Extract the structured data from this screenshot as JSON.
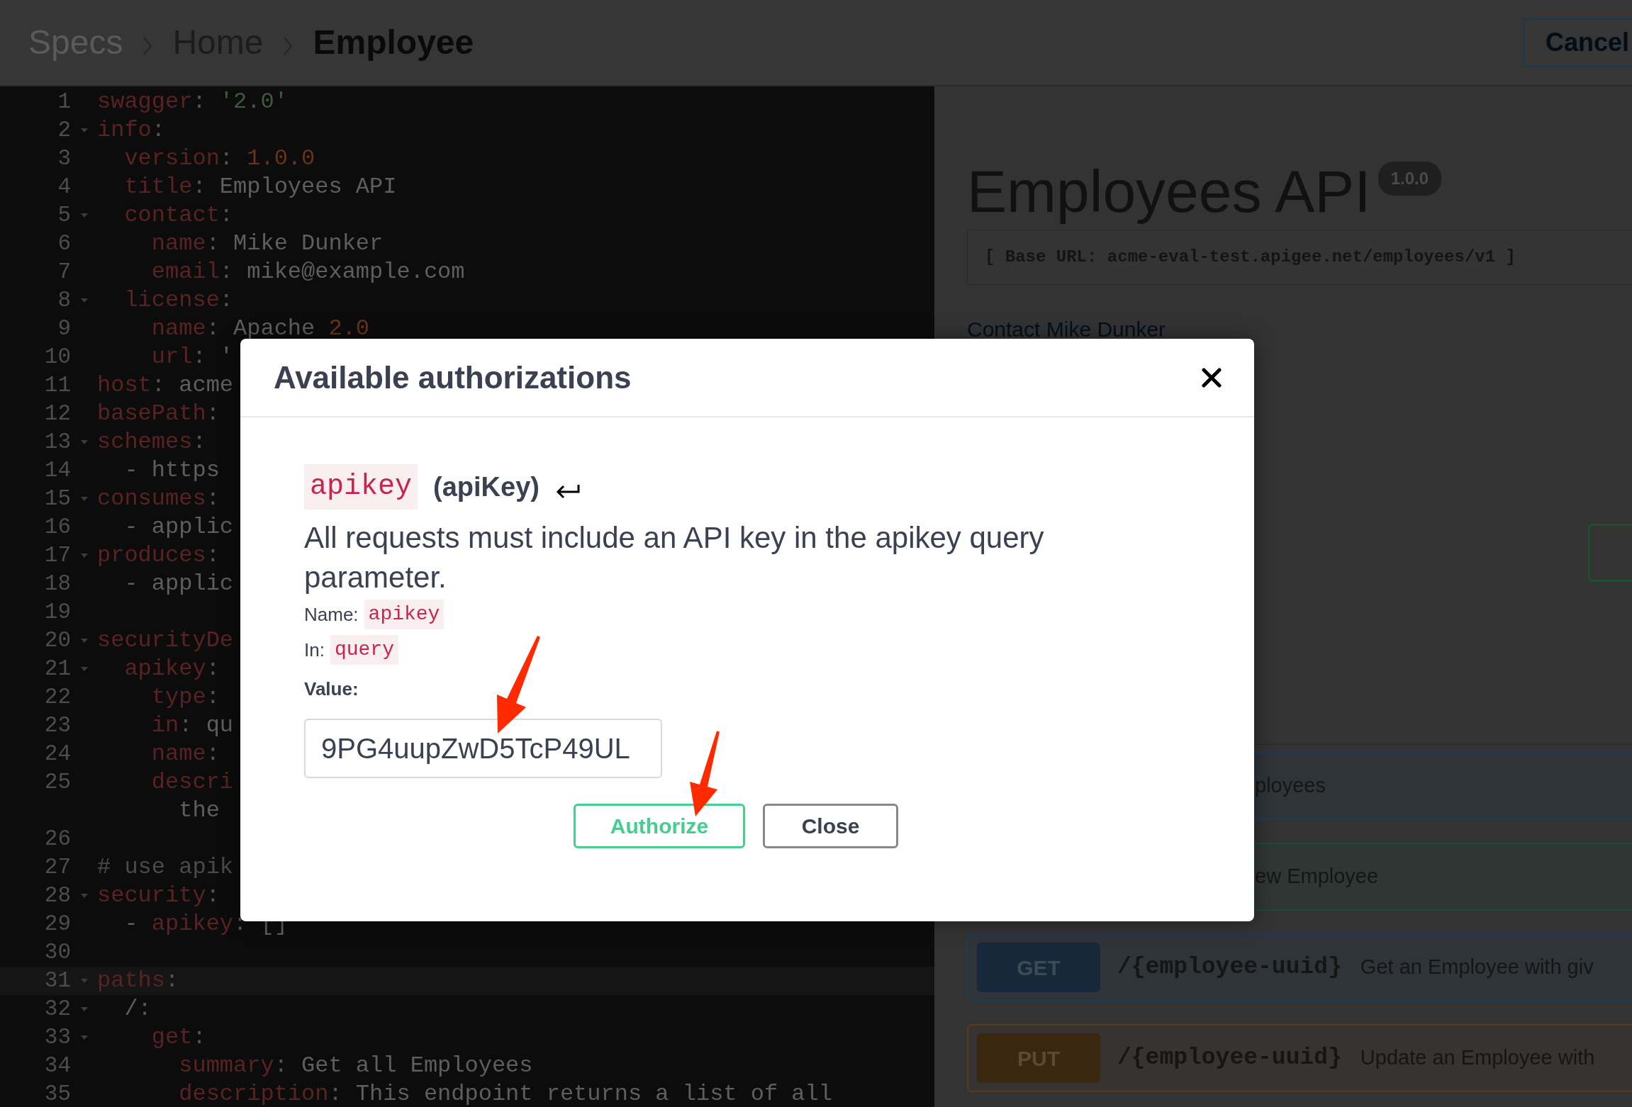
{
  "breadcrumb": [
    {
      "label": "Specs",
      "current": false
    },
    {
      "label": "Home",
      "current": false
    },
    {
      "label": "Employee",
      "current": true
    }
  ],
  "cancel_button": "Cancel",
  "editor": {
    "lines": [
      {
        "number": "1",
        "fold": false,
        "active": false,
        "tokens": [
          {
            "kind": "key",
            "text": "swagger"
          },
          {
            "kind": "punct",
            "text": ": "
          },
          {
            "kind": "string",
            "text": "'2.0'"
          }
        ]
      },
      {
        "number": "2",
        "fold": true,
        "active": false,
        "tokens": [
          {
            "kind": "key",
            "text": "info"
          },
          {
            "kind": "punct",
            "text": ":"
          }
        ]
      },
      {
        "number": "3",
        "fold": false,
        "active": false,
        "tokens": [
          {
            "kind": "key",
            "text": "  version"
          },
          {
            "kind": "punct",
            "text": ": "
          },
          {
            "kind": "number",
            "text": "1.0.0"
          }
        ]
      },
      {
        "number": "4",
        "fold": false,
        "active": false,
        "tokens": [
          {
            "kind": "key",
            "text": "  title"
          },
          {
            "kind": "punct",
            "text": ": "
          },
          {
            "kind": "text",
            "text": "Employees API"
          }
        ]
      },
      {
        "number": "5",
        "fold": true,
        "active": false,
        "tokens": [
          {
            "kind": "key",
            "text": "  contact"
          },
          {
            "kind": "punct",
            "text": ":"
          }
        ]
      },
      {
        "number": "6",
        "fold": false,
        "active": false,
        "tokens": [
          {
            "kind": "key",
            "text": "    name"
          },
          {
            "kind": "punct",
            "text": ": "
          },
          {
            "kind": "text",
            "text": "Mike Dunker"
          }
        ]
      },
      {
        "number": "7",
        "fold": false,
        "active": false,
        "tokens": [
          {
            "kind": "key",
            "text": "    email"
          },
          {
            "kind": "punct",
            "text": ": "
          },
          {
            "kind": "text",
            "text": "mike@example.com"
          }
        ]
      },
      {
        "number": "8",
        "fold": true,
        "active": false,
        "tokens": [
          {
            "kind": "key",
            "text": "  license"
          },
          {
            "kind": "punct",
            "text": ":"
          }
        ]
      },
      {
        "number": "9",
        "fold": false,
        "active": false,
        "tokens": [
          {
            "kind": "key",
            "text": "    name"
          },
          {
            "kind": "punct",
            "text": ": "
          },
          {
            "kind": "text",
            "text": "Apache "
          },
          {
            "kind": "number",
            "text": "2.0"
          }
        ]
      },
      {
        "number": "10",
        "fold": false,
        "active": false,
        "tokens": [
          {
            "kind": "key",
            "text": "    url"
          },
          {
            "kind": "punct",
            "text": ": "
          },
          {
            "kind": "text",
            "text": "'"
          }
        ]
      },
      {
        "number": "11",
        "fold": false,
        "active": false,
        "tokens": [
          {
            "kind": "key",
            "text": "host"
          },
          {
            "kind": "punct",
            "text": ": "
          },
          {
            "kind": "text",
            "text": "acme"
          }
        ]
      },
      {
        "number": "12",
        "fold": false,
        "active": false,
        "tokens": [
          {
            "kind": "key",
            "text": "basePath"
          },
          {
            "kind": "punct",
            "text": ":"
          }
        ]
      },
      {
        "number": "13",
        "fold": true,
        "active": false,
        "tokens": [
          {
            "kind": "key",
            "text": "schemes"
          },
          {
            "kind": "punct",
            "text": ":"
          }
        ]
      },
      {
        "number": "14",
        "fold": false,
        "active": false,
        "tokens": [
          {
            "kind": "text",
            "text": "  - https"
          }
        ]
      },
      {
        "number": "15",
        "fold": true,
        "active": false,
        "tokens": [
          {
            "kind": "key",
            "text": "consumes"
          },
          {
            "kind": "punct",
            "text": ":"
          }
        ]
      },
      {
        "number": "16",
        "fold": false,
        "active": false,
        "tokens": [
          {
            "kind": "text",
            "text": "  - applic"
          }
        ]
      },
      {
        "number": "17",
        "fold": true,
        "active": false,
        "tokens": [
          {
            "kind": "key",
            "text": "produces"
          },
          {
            "kind": "punct",
            "text": ":"
          }
        ]
      },
      {
        "number": "18",
        "fold": false,
        "active": false,
        "tokens": [
          {
            "kind": "text",
            "text": "  - applic"
          }
        ]
      },
      {
        "number": "19",
        "fold": false,
        "active": false
      },
      {
        "number": "20",
        "fold": true,
        "active": false,
        "tokens": [
          {
            "kind": "key",
            "text": "securityDe"
          }
        ]
      },
      {
        "number": "21",
        "fold": true,
        "active": false,
        "tokens": [
          {
            "kind": "key",
            "text": "  apikey"
          },
          {
            "kind": "punct",
            "text": ":"
          }
        ]
      },
      {
        "number": "22",
        "fold": false,
        "active": false,
        "tokens": [
          {
            "kind": "key",
            "text": "    type"
          },
          {
            "kind": "punct",
            "text": ":"
          }
        ]
      },
      {
        "number": "23",
        "fold": false,
        "active": false,
        "tokens": [
          {
            "kind": "key",
            "text": "    in"
          },
          {
            "kind": "punct",
            "text": ": "
          },
          {
            "kind": "text",
            "text": "qu"
          }
        ]
      },
      {
        "number": "24",
        "fold": false,
        "active": false,
        "tokens": [
          {
            "kind": "key",
            "text": "    name"
          },
          {
            "kind": "punct",
            "text": ":"
          }
        ]
      },
      {
        "number": "25",
        "fold": false,
        "active": false,
        "tokens": [
          {
            "kind": "key",
            "text": "    descri"
          }
        ]
      },
      {
        "fold": false,
        "active": false,
        "tokens": [
          {
            "kind": "text",
            "text": "      the"
          }
        ]
      },
      {
        "number": "26",
        "fold": false,
        "active": false
      },
      {
        "number": "27",
        "fold": false,
        "active": false,
        "tokens": [
          {
            "kind": "comment",
            "text": "# use apik"
          }
        ]
      },
      {
        "number": "28",
        "fold": true,
        "active": false,
        "tokens": [
          {
            "kind": "key",
            "text": "security"
          },
          {
            "kind": "punct",
            "text": ":"
          }
        ]
      },
      {
        "number": "29",
        "fold": false,
        "active": false,
        "tokens": [
          {
            "kind": "text",
            "text": "  - "
          },
          {
            "kind": "key",
            "text": "apikey"
          },
          {
            "kind": "punct",
            "text": ": "
          },
          {
            "kind": "text",
            "text": "[]"
          }
        ]
      },
      {
        "number": "30",
        "fold": false,
        "active": false
      },
      {
        "number": "31",
        "fold": true,
        "active": true,
        "tokens": [
          {
            "kind": "key",
            "text": "paths"
          },
          {
            "kind": "punct",
            "text": ":"
          }
        ]
      },
      {
        "number": "32",
        "fold": true,
        "active": false,
        "tokens": [
          {
            "kind": "text",
            "text": "  /"
          },
          {
            "kind": "punct",
            "text": ":"
          }
        ]
      },
      {
        "number": "33",
        "fold": true,
        "active": false,
        "tokens": [
          {
            "kind": "key",
            "text": "    get"
          },
          {
            "kind": "punct",
            "text": ":"
          }
        ]
      },
      {
        "number": "34",
        "fold": false,
        "active": false,
        "tokens": [
          {
            "kind": "key",
            "text": "      summary"
          },
          {
            "kind": "punct",
            "text": ": "
          },
          {
            "kind": "text",
            "text": "Get all Employees"
          }
        ]
      },
      {
        "number": "35",
        "fold": false,
        "active": false,
        "tokens": [
          {
            "kind": "key",
            "text": "      description"
          },
          {
            "kind": "punct",
            "text": ": "
          },
          {
            "kind": "text",
            "text": "This endpoint returns a list of all"
          }
        ]
      }
    ]
  },
  "spec": {
    "title": "Employees API",
    "version": "1.0.0",
    "base_url": "[ Base URL: acme-eval-test.apigee.net/employees/v1 ]",
    "contact_link": "Contact Mike Dunker",
    "operations": [
      {
        "kind": "get",
        "summary": "ployees"
      },
      {
        "kind": "post",
        "summary": "ew Employee"
      },
      {
        "kind": "get",
        "method": "GET",
        "path": "/{employee-uuid}",
        "summary": "Get an Employee with giv"
      },
      {
        "kind": "put",
        "method": "PUT",
        "path": "/{employee-uuid}",
        "summary": "Update an Employee with"
      }
    ]
  },
  "modal": {
    "title": "Available authorizations",
    "scheme_name": "apikey",
    "scheme_type": "(apiKey)",
    "description": "All requests must include an API key in the apikey query parameter.",
    "name_label": "Name:",
    "name_value": "apikey",
    "in_label": "In:",
    "in_value": "query",
    "value_label": "Value:",
    "value": "9PG4uupZwD5TcP49UL",
    "buttons": [
      {
        "kind": "primary",
        "label": "Authorize"
      },
      {
        "kind": "secondary",
        "label": "Close"
      }
    ]
  }
}
